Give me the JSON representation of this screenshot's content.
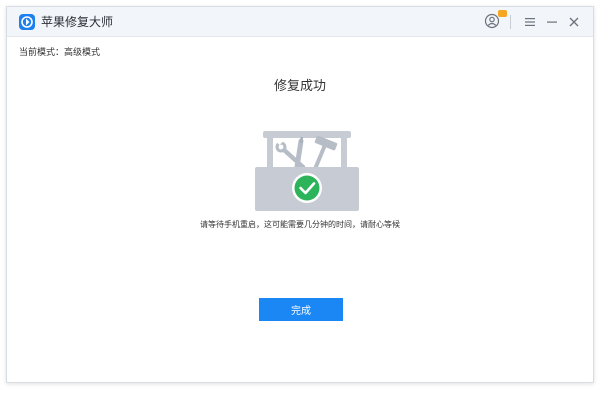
{
  "app": {
    "title": "苹果修复大师"
  },
  "header": {
    "mode_label": "当前模式：高级模式",
    "page_title": "修复成功"
  },
  "main": {
    "hint": "请等待手机重启，这可能需要几分钟的时间，请耐心等候",
    "done_label": "完成"
  },
  "icons": {
    "logo": "app-logo-icon",
    "user": "user-icon",
    "menu": "menu-icon",
    "minimize": "minimize-icon",
    "close": "close-icon",
    "illustration": "toolbox-success-illustration"
  },
  "colors": {
    "accent": "#1b87f5",
    "success": "#2db35a",
    "titlebar_bg": "#f2f5f9",
    "badge": "#f5a623"
  }
}
